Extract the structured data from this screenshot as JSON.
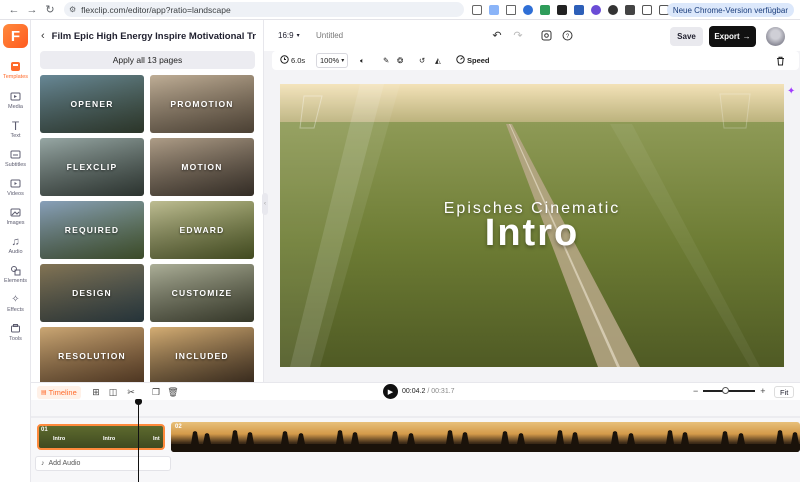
{
  "browser": {
    "url": "flexclip.com/editor/app?ratio=landscape",
    "update_pill": "Neue Chrome-Version verfügbar"
  },
  "rail": {
    "logo_letter": "F",
    "items": [
      {
        "label": "Templates",
        "icon": "templates-icon",
        "active": true
      },
      {
        "label": "Media",
        "icon": "media-icon"
      },
      {
        "label": "Text",
        "icon": "text-icon"
      },
      {
        "label": "Subtitles",
        "icon": "subtitles-icon"
      },
      {
        "label": "Videos",
        "icon": "videos-icon"
      },
      {
        "label": "Images",
        "icon": "images-icon"
      },
      {
        "label": "Audio",
        "icon": "audio-icon"
      },
      {
        "label": "Elements",
        "icon": "elements-icon"
      },
      {
        "label": "Effects",
        "icon": "effects-icon"
      },
      {
        "label": "Tools",
        "icon": "tools-icon"
      }
    ]
  },
  "panel": {
    "title": "Film Epic High Energy Inspire Motivational Tra...",
    "apply_label": "Apply all 13 pages",
    "thumbs": [
      {
        "label": "OPENER",
        "colors": [
          "#6d8f9e",
          "#3e4c3a"
        ]
      },
      {
        "label": "PROMOTION",
        "colors": [
          "#c9b79e",
          "#6b5c4a"
        ]
      },
      {
        "label": "FLEXCLIP",
        "colors": [
          "#9fb0ad",
          "#3f4a44"
        ]
      },
      {
        "label": "MOTION",
        "colors": [
          "#b7a58e",
          "#4a4036"
        ]
      },
      {
        "label": "REQUIRED",
        "colors": [
          "#8fa8c4",
          "#556b3a"
        ]
      },
      {
        "label": "EDWARD",
        "colors": [
          "#c8c79a",
          "#5e6a2e"
        ]
      },
      {
        "label": "DESIGN",
        "colors": [
          "#8a7a58",
          "#364a52"
        ]
      },
      {
        "label": "CUSTOMIZE",
        "colors": [
          "#b5b8a0",
          "#4c4f3a"
        ]
      },
      {
        "label": "RESOLUTION",
        "colors": [
          "#d6b07a",
          "#6b4a2e"
        ]
      },
      {
        "label": "INCLUDED",
        "colors": [
          "#e0b77a",
          "#4d3a28"
        ]
      }
    ]
  },
  "topbar": {
    "ratio": "16:9",
    "project_name": "Untitled",
    "save_label": "Save",
    "export_label": "Export"
  },
  "toolbar": {
    "duration": "6.0s",
    "zoom": "100%",
    "speed_label": "Speed"
  },
  "canvas": {
    "subtitle": "Episches Cinematic",
    "title": "Intro"
  },
  "timeline": {
    "tab_label": "Timeline",
    "current_time": "00:04.2",
    "total_time": "/ 00:31.7",
    "fit_label": "Fit",
    "clip1_number": "01",
    "clip1_labels": [
      "Intro",
      "Intro",
      "Int"
    ],
    "clip2_number": "02",
    "add_audio_label": "Add Audio"
  }
}
